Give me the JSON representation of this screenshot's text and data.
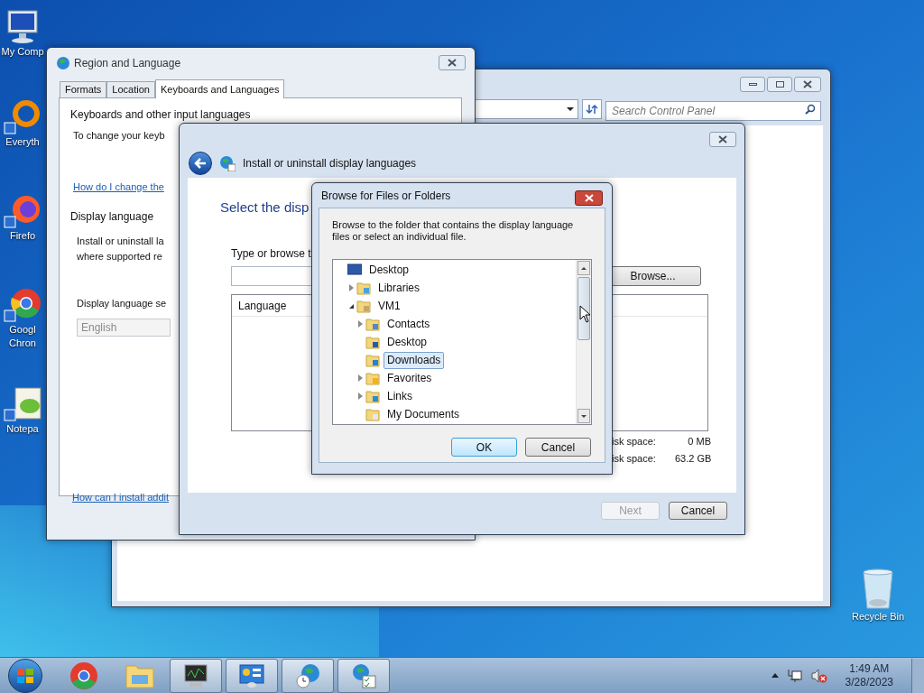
{
  "desktop_icons": [
    {
      "kind": "computer",
      "label_lines": [
        "My Comp"
      ]
    },
    {
      "kind": "everything",
      "label_lines": [
        "Everyth"
      ]
    },
    {
      "kind": "firefox",
      "label_lines": [
        "Firefo"
      ]
    },
    {
      "kind": "chrome",
      "label_lines": [
        "Googl",
        "Chron"
      ]
    },
    {
      "kind": "notepad",
      "label_lines": [
        "Notepa"
      ]
    },
    {
      "kind": "recycle",
      "label_lines": [
        "Recycle Bin"
      ]
    }
  ],
  "control_panel": {
    "search": {
      "placeholder": "Search Control Panel"
    }
  },
  "region_window": {
    "title": "Region and Language",
    "tabs": [
      {
        "label": "Formats",
        "selected": false
      },
      {
        "label": "Location",
        "selected": false
      },
      {
        "label": "Keyboards and Languages",
        "selected": true
      }
    ],
    "keyboards_section": {
      "heading": "Keyboards and other input languages",
      "text": "To change your keyb",
      "link": "How do I change the"
    },
    "display_section": {
      "heading": "Display language",
      "text_lines": [
        "Install or uninstall la",
        "where supported re"
      ],
      "select_label": "Display language se",
      "select": {
        "value": "English",
        "disabled": true
      }
    },
    "footer_link": "How can I install addit"
  },
  "install_window": {
    "title": "Install or uninstall display languages",
    "heading": "Select the disp",
    "field_label": "Type or browse t",
    "browse_button": "Browse...",
    "table": {
      "columns": [
        "Language"
      ]
    },
    "disk_space": [
      {
        "label": "isk space:",
        "value": "0 MB"
      },
      {
        "label": "isk space:",
        "value": "63.2 GB"
      }
    ],
    "buttons": [
      {
        "label": "Next",
        "disabled": true
      },
      {
        "label": "Cancel",
        "disabled": false
      }
    ]
  },
  "browse_dialog": {
    "title": "Browse for Files or Folders",
    "instruction": "Browse to the folder that contains the display language files or select an individual file.",
    "tree": [
      {
        "label": "Desktop",
        "kind": "desktop",
        "arrow": false,
        "selected": false,
        "children": [
          {
            "label": "Libraries",
            "kind": "libraries",
            "arrow": true,
            "expanded": false,
            "selected": false
          },
          {
            "label": "VM1",
            "kind": "user",
            "arrow": true,
            "expanded": true,
            "selected": false,
            "children": [
              {
                "label": "Contacts",
                "kind": "contacts",
                "arrow": true,
                "expanded": false,
                "selected": false
              },
              {
                "label": "Desktop",
                "kind": "desktop-folder",
                "arrow": false,
                "selected": false
              },
              {
                "label": "Downloads",
                "kind": "downloads",
                "arrow": false,
                "selected": true
              },
              {
                "label": "Favorites",
                "kind": "favorites",
                "arrow": true,
                "expanded": false,
                "selected": false
              },
              {
                "label": "Links",
                "kind": "links",
                "arrow": true,
                "expanded": false,
                "selected": false
              },
              {
                "label": "My Documents",
                "kind": "documents",
                "arrow": false,
                "selected": false
              }
            ]
          }
        ]
      }
    ],
    "buttons": [
      {
        "label": "OK",
        "default": true
      },
      {
        "label": "Cancel",
        "default": false
      }
    ]
  },
  "taskbar": {
    "pinned": [
      {
        "kind": "chrome",
        "running": false
      },
      {
        "kind": "explorer",
        "running": false
      },
      {
        "kind": "monitor",
        "running": true
      },
      {
        "kind": "control-panel",
        "running": true
      },
      {
        "kind": "globe-clock",
        "running": true
      },
      {
        "kind": "globe-list",
        "running": true
      }
    ],
    "time": "1:49 AM",
    "date": "3/28/2023"
  }
}
